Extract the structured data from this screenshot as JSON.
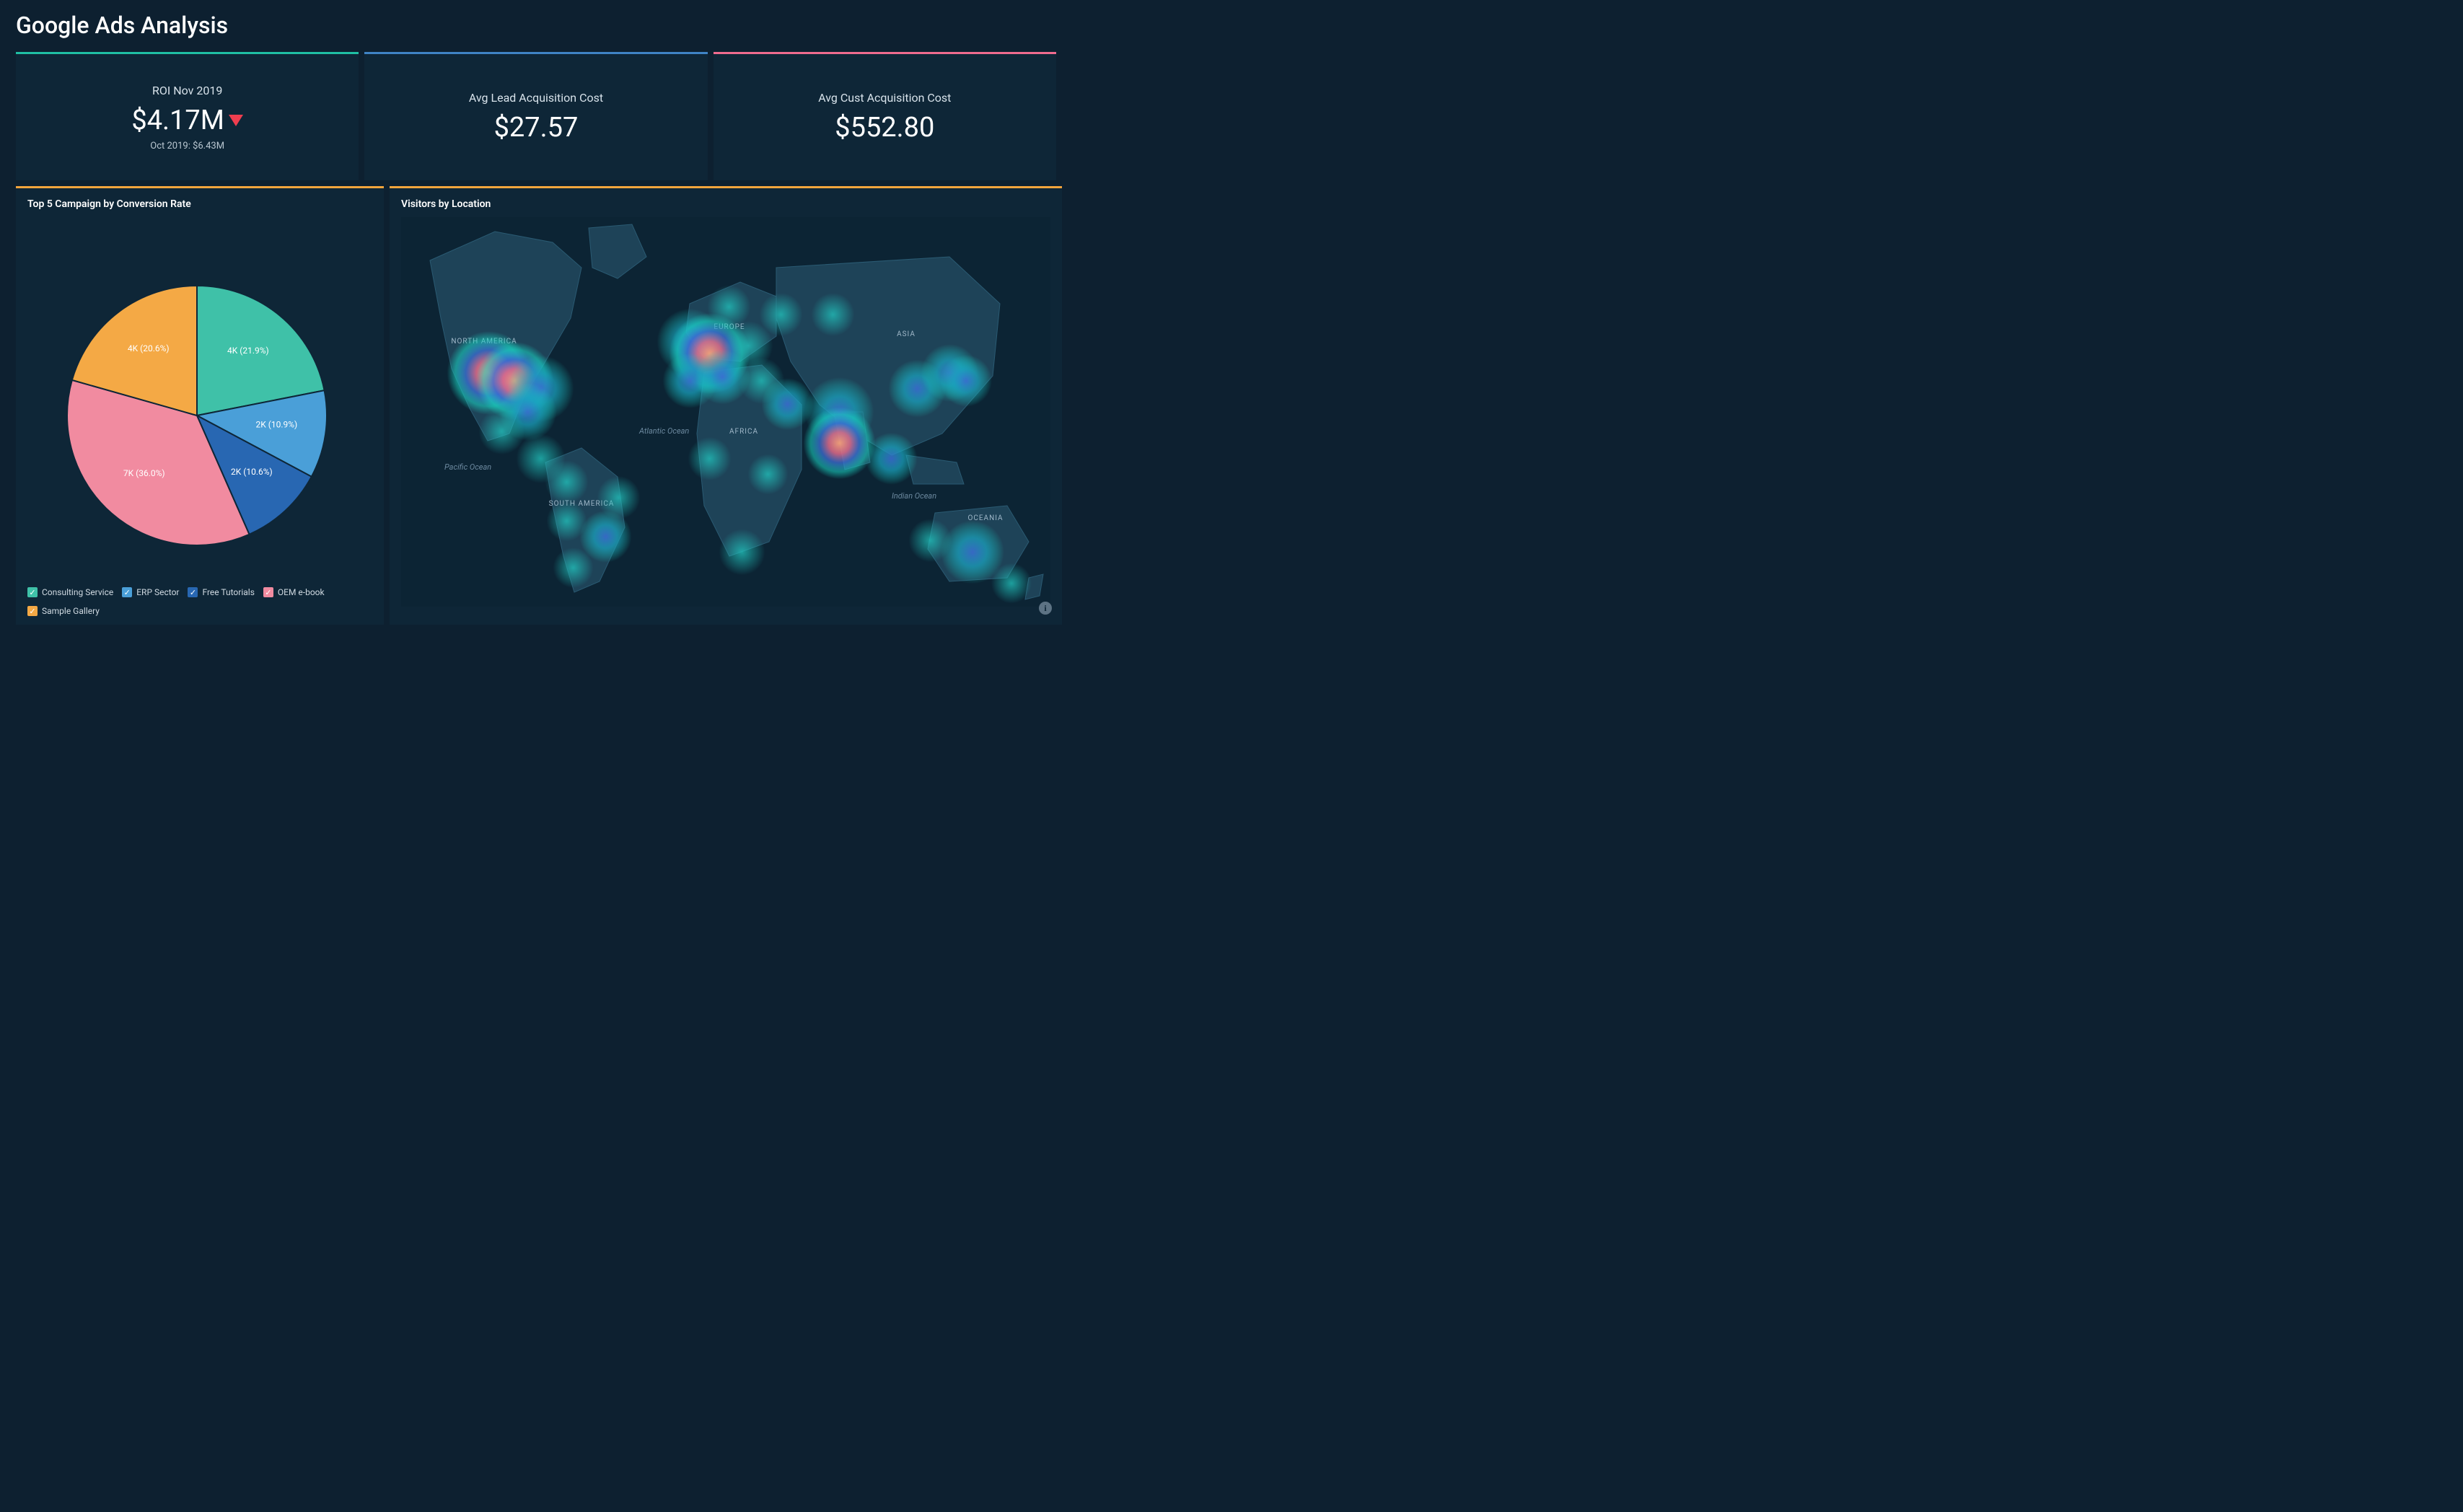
{
  "page": {
    "title": "Google Ads Analysis"
  },
  "kpis": {
    "roi": {
      "label": "ROI Nov 2019",
      "value": "$4.17M",
      "trend": "down",
      "sub": "Oct 2019: $6.43M",
      "accent": "#1fbfa4"
    },
    "lead": {
      "label": "Avg Lead Acquisition Cost",
      "value": "$27.57",
      "accent": "#3f84c5"
    },
    "cust": {
      "label": "Avg Cust Acquisition Cost",
      "value": "$552.80",
      "accent": "#ef6b8f"
    }
  },
  "pie_panel": {
    "title": "Top 5 Campaign by Conversion Rate"
  },
  "map_panel": {
    "title": "Visitors by Location"
  },
  "legend_check": "✓",
  "chart_data": [
    {
      "type": "pie",
      "title": "Top 5 Campaign by Conversion Rate",
      "series": [
        {
          "name": "Consulting Service",
          "value_label": "4K",
          "percent": 21.9,
          "color": "#3fc1a8"
        },
        {
          "name": "ERP Sector",
          "value_label": "2K",
          "percent": 10.9,
          "color": "#4a9fd8"
        },
        {
          "name": "Free Tutorials",
          "value_label": "2K",
          "percent": 10.6,
          "color": "#2867b2"
        },
        {
          "name": "OEM e-book",
          "value_label": "7K",
          "percent": 36.0,
          "color": "#f18ba0"
        },
        {
          "name": "Sample Gallery",
          "value_label": "4K",
          "percent": 20.6,
          "color": "#f4a945"
        }
      ]
    },
    {
      "type": "heatmap",
      "title": "Visitors by Location",
      "note": "Geo heat-map of visitor density; hotspots in western US, western Europe, India, east Asia, southeast Australia, scattered South America & Africa.",
      "continent_labels": [
        "NORTH AMERICA",
        "SOUTH AMERICA",
        "EUROPE",
        "AFRICA",
        "ASIA",
        "OCEANIA"
      ],
      "ocean_labels": [
        "Pacific Ocean",
        "Atlantic Ocean",
        "Indian Ocean"
      ],
      "hotspots": [
        {
          "region": "US West",
          "x": 0.135,
          "y": 0.4,
          "intensity": 1.0
        },
        {
          "region": "US Central",
          "x": 0.175,
          "y": 0.42,
          "intensity": 0.9
        },
        {
          "region": "US East",
          "x": 0.215,
          "y": 0.44,
          "intensity": 0.7
        },
        {
          "region": "US South",
          "x": 0.195,
          "y": 0.5,
          "intensity": 0.55
        },
        {
          "region": "Mexico",
          "x": 0.155,
          "y": 0.55,
          "intensity": 0.35
        },
        {
          "region": "Central America",
          "x": 0.215,
          "y": 0.62,
          "intensity": 0.4
        },
        {
          "region": "Colombia",
          "x": 0.255,
          "y": 0.68,
          "intensity": 0.3
        },
        {
          "region": "Peru",
          "x": 0.255,
          "y": 0.78,
          "intensity": 0.25
        },
        {
          "region": "Chile",
          "x": 0.265,
          "y": 0.9,
          "intensity": 0.25
        },
        {
          "region": "Brazil SE",
          "x": 0.315,
          "y": 0.82,
          "intensity": 0.45
        },
        {
          "region": "Brazil NE",
          "x": 0.335,
          "y": 0.72,
          "intensity": 0.3
        },
        {
          "region": "UK",
          "x": 0.445,
          "y": 0.32,
          "intensity": 0.7
        },
        {
          "region": "France/Germany",
          "x": 0.475,
          "y": 0.35,
          "intensity": 0.95
        },
        {
          "region": "Spain",
          "x": 0.445,
          "y": 0.42,
          "intensity": 0.5
        },
        {
          "region": "Italy",
          "x": 0.495,
          "y": 0.41,
          "intensity": 0.5
        },
        {
          "region": "Scandinavia",
          "x": 0.505,
          "y": 0.23,
          "intensity": 0.3
        },
        {
          "region": "E. Europe",
          "x": 0.535,
          "y": 0.33,
          "intensity": 0.4
        },
        {
          "region": "Turkey",
          "x": 0.555,
          "y": 0.42,
          "intensity": 0.35
        },
        {
          "region": "Russia W",
          "x": 0.585,
          "y": 0.25,
          "intensity": 0.3
        },
        {
          "region": "Russia C",
          "x": 0.665,
          "y": 0.25,
          "intensity": 0.3
        },
        {
          "region": "Middle East",
          "x": 0.595,
          "y": 0.48,
          "intensity": 0.45
        },
        {
          "region": "India N",
          "x": 0.675,
          "y": 0.5,
          "intensity": 0.75
        },
        {
          "region": "India S",
          "x": 0.675,
          "y": 0.58,
          "intensity": 0.8
        },
        {
          "region": "SE Asia",
          "x": 0.755,
          "y": 0.62,
          "intensity": 0.45
        },
        {
          "region": "China E",
          "x": 0.795,
          "y": 0.44,
          "intensity": 0.55
        },
        {
          "region": "Korea/Japan",
          "x": 0.845,
          "y": 0.4,
          "intensity": 0.55
        },
        {
          "region": "Japan",
          "x": 0.87,
          "y": 0.42,
          "intensity": 0.45
        },
        {
          "region": "Nigeria",
          "x": 0.475,
          "y": 0.62,
          "intensity": 0.3
        },
        {
          "region": "South Africa",
          "x": 0.525,
          "y": 0.86,
          "intensity": 0.35
        },
        {
          "region": "East Africa",
          "x": 0.565,
          "y": 0.66,
          "intensity": 0.25
        },
        {
          "region": "Australia SE",
          "x": 0.88,
          "y": 0.86,
          "intensity": 0.65
        },
        {
          "region": "Australia W",
          "x": 0.815,
          "y": 0.83,
          "intensity": 0.3
        },
        {
          "region": "New Zealand",
          "x": 0.94,
          "y": 0.94,
          "intensity": 0.25
        }
      ]
    }
  ]
}
